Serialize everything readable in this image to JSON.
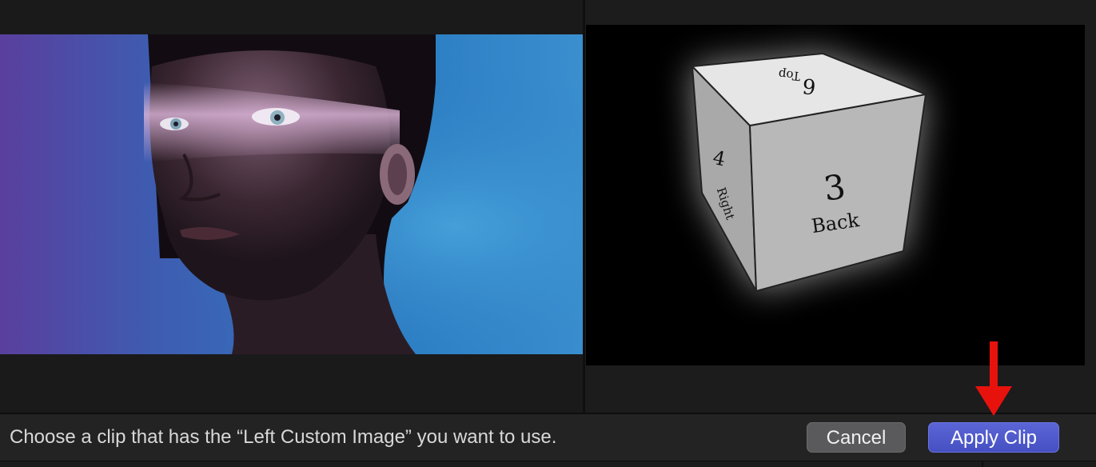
{
  "prompt": {
    "message": "Choose a clip that has the “Left Custom Image” you want to use."
  },
  "buttons": {
    "cancel_label": "Cancel",
    "apply_label": "Apply Clip"
  },
  "left_preview": {
    "content": "portrait-photo",
    "accent_color": "#2f7fc0"
  },
  "cube_preview": {
    "top_face": {
      "number": "6",
      "label": "Top"
    },
    "left_face": {
      "number": "4",
      "label": "Right"
    },
    "front_face": {
      "number": "3",
      "label": "Back"
    }
  },
  "annotation": {
    "arrow_color": "#e8120c",
    "icon": "down-arrow-icon"
  },
  "colors": {
    "apply_button": "#4f5ad0",
    "cancel_button": "#5a5a5c",
    "background": "#1c1c1d"
  }
}
